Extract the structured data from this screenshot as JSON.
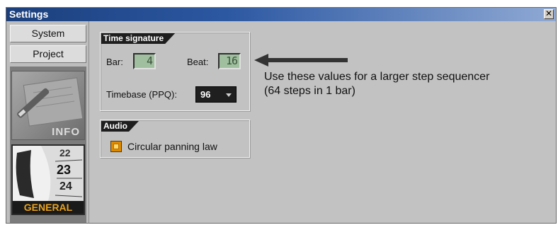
{
  "window": {
    "title": "Settings",
    "close_glyph": "✕"
  },
  "sidebar": {
    "items": [
      {
        "label": "System"
      },
      {
        "label": "Project"
      }
    ],
    "info_tile": {
      "label": "INFO",
      "icon": "pen-on-paper-icon"
    },
    "general_tile": {
      "label": "GENERAL",
      "icon": "calendar-dial-icon",
      "numbers": [
        "22",
        "23",
        "24"
      ]
    }
  },
  "time_signature": {
    "title": "Time signature",
    "bar_label": "Bar:",
    "bar_value": "4",
    "beat_label": "Beat:",
    "beat_value": "16",
    "timebase_label": "Timebase (PPQ):",
    "timebase_value": "96"
  },
  "audio": {
    "title": "Audio",
    "circular_panning_label": "Circular panning law",
    "circular_panning_checked": true
  },
  "annotation": {
    "line1": "Use these values for a larger step sequencer",
    "line2": "(64 steps in 1 bar)"
  },
  "colors": {
    "titlebar": "#1b3f7c",
    "panel_background": "#c2c2c2",
    "lcd_background": "#9fbf9f",
    "checkbox": "#e08a00",
    "general_label": "#e8a21c"
  }
}
